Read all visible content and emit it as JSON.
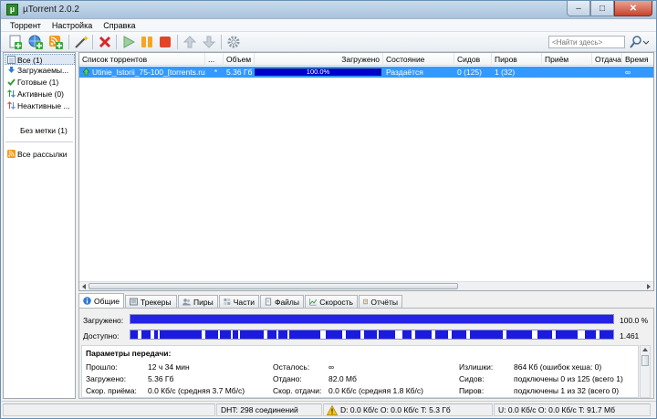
{
  "window": {
    "title": "µTorrent 2.0.2",
    "min": "–",
    "max": "□",
    "close": "✕"
  },
  "menu": [
    "Торрент",
    "Настройка",
    "Справка"
  ],
  "search": {
    "placeholder": "<Найти здесь>"
  },
  "sidebar": {
    "items": [
      {
        "label": "Все (1)",
        "icon": "all-icon"
      },
      {
        "label": "Загружаемы...",
        "icon": "download-arrow-icon"
      },
      {
        "label": "Готовые (1)",
        "icon": "check-icon"
      },
      {
        "label": "Активные (0)",
        "icon": "active-arrows-icon"
      },
      {
        "label": "Неактивные ...",
        "icon": "inactive-arrows-icon"
      }
    ],
    "no_label": "Без метки (1)",
    "feeds": "Все рассылки"
  },
  "list": {
    "columns": [
      "Список торрентов",
      "...",
      "Объем",
      "Загружено",
      "Состояние",
      "Сидов",
      "Пиров",
      "Приём",
      "Отдача",
      "Время"
    ],
    "rows": [
      {
        "name": "Utinie_Istorii_75-100_[torrents.ru]",
        "flag": "*",
        "size": "5.36 Гб",
        "progress_text": "100.0%",
        "progress": 100,
        "status": "Раздаётся",
        "seeds": "0 (125)",
        "peers": "1 (32)",
        "down": "",
        "up": "",
        "eta": "∞"
      }
    ]
  },
  "tabs": [
    "Общие",
    "Трекеры",
    "Пиры",
    "Части",
    "Файлы",
    "Скорость",
    "Отчёты"
  ],
  "detail": {
    "downloaded_label": "Загружено:",
    "downloaded_value": "100.0 %",
    "downloaded_pct": 100,
    "available_label": "Доступно:",
    "available_value": "1.461",
    "params_title": "Параметры передачи:",
    "col1": [
      {
        "label": "Прошло:",
        "value": "12 ч 34 мин"
      },
      {
        "label": "Загружено:",
        "value": "5.36 Гб"
      },
      {
        "label": "Скор. приёма:",
        "value": "0.0 Кб/с (средняя 3.7 Мб/с)"
      }
    ],
    "col2": [
      {
        "label": "Осталось:",
        "value": "∞"
      },
      {
        "label": "Отдано:",
        "value": "82.0 Мб"
      },
      {
        "label": "Скор. отдачи:",
        "value": "0.0 Кб/с (средняя 1.8 Кб/с)"
      }
    ],
    "col3": [
      {
        "label": "Излишки:",
        "value": "864 Кб (ошибок хеша: 0)"
      },
      {
        "label": "Сидов:",
        "value": "подключены 0 из 125 (всего 1)"
      },
      {
        "label": "Пиров:",
        "value": "подключены 1 из 32 (всего 0)"
      }
    ]
  },
  "status": {
    "dht": "DHT: 298 соединений",
    "traffic_down": "D: 0.0 Кб/с O: 0.0 Кб/с T: 5.3 Гб",
    "traffic_up": "U: 0.0 Кб/с O: 0.0 Кб/с T: 91.7 Мб"
  },
  "colors": {
    "selection": "#3399ff",
    "progress": "#0000cc",
    "avail": "#1a1ae0"
  }
}
